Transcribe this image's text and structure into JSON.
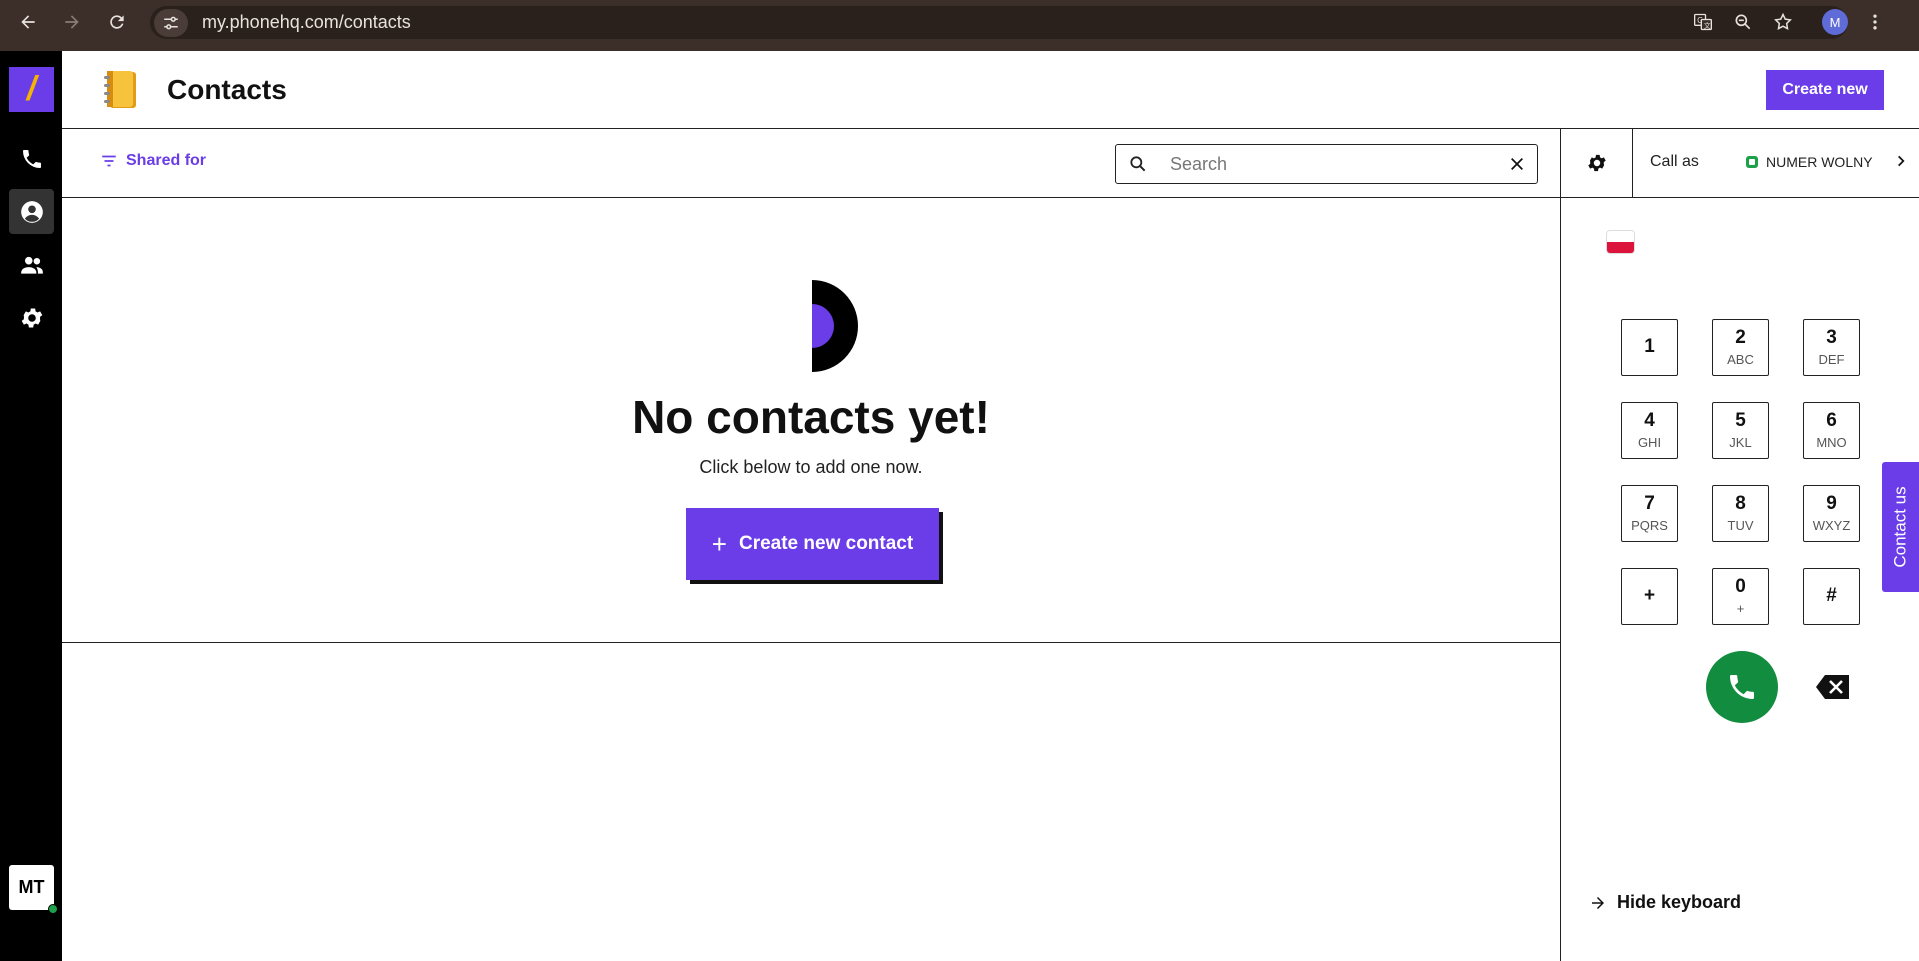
{
  "browser": {
    "url": "my.phonehq.com/contacts",
    "profile_initial": "M"
  },
  "header": {
    "title": "Contacts",
    "create_label": "Create new"
  },
  "rail": {
    "user_initials": "MT"
  },
  "toolbar": {
    "filter_label": "Shared for",
    "search_placeholder": "Search"
  },
  "empty_state": {
    "title": "No contacts yet!",
    "subtitle": "Click below to add one now.",
    "cta_label": "Create new contact"
  },
  "dialer": {
    "call_as_label": "Call as",
    "number_name": "NUMER WOLNY",
    "keys": [
      {
        "digit": "1",
        "letters": ""
      },
      {
        "digit": "2",
        "letters": "ABC"
      },
      {
        "digit": "3",
        "letters": "DEF"
      },
      {
        "digit": "4",
        "letters": "GHI"
      },
      {
        "digit": "5",
        "letters": "JKL"
      },
      {
        "digit": "6",
        "letters": "MNO"
      },
      {
        "digit": "7",
        "letters": "PQRS"
      },
      {
        "digit": "8",
        "letters": "TUV"
      },
      {
        "digit": "9",
        "letters": "WXYZ"
      },
      {
        "digit": "+",
        "letters": ""
      },
      {
        "digit": "0",
        "letters": "+"
      },
      {
        "digit": "#",
        "letters": ""
      }
    ],
    "hide_keyboard_label": "Hide keyboard"
  },
  "contact_tab_label": "Contact us",
  "colors": {
    "accent": "#6a3de8",
    "call_green": "#128c3e",
    "logo_mark": "#f5b400"
  }
}
